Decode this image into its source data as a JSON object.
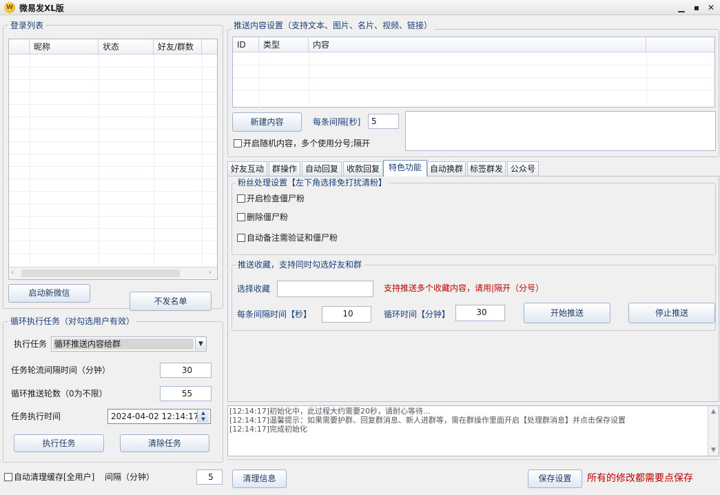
{
  "window": {
    "title": "微易发XL版",
    "icon": "W"
  },
  "login_list": {
    "title": "登录列表",
    "columns": [
      "昵称",
      "状态",
      "好友/群数"
    ],
    "start_button": "启动新微信",
    "blacklist_button": "不发名单"
  },
  "loop_task": {
    "title": "循环执行任务（对勾选用户有效）",
    "task_label": "执行任务",
    "task_value": "循环推送内容给群",
    "interval_label": "任务轮流间隔时间（分钟）",
    "interval_value": "30",
    "rounds_label": "循环推送轮数（0为不限）",
    "rounds_value": "55",
    "time_label": "任务执行时间",
    "time_value": "2024-04-02 12:14:17",
    "run_button": "执行任务",
    "clear_button": "清除任务"
  },
  "cache": {
    "checkbox_label": "自动清理缓存[全用户]",
    "interval_label": "间隔（分钟）",
    "interval_value": "5"
  },
  "push_content": {
    "title": "推送内容设置（支持文本、图片、名片、视频、链接）",
    "columns": [
      "ID",
      "类型",
      "内容"
    ],
    "new_button": "新建内容",
    "interval_label": "每条间隔[秒]",
    "interval_value": "5",
    "random_label": "开启随机内容，多个使用分号;隔开"
  },
  "tabs": [
    "好友互动",
    "群操作",
    "自动回复",
    "收款回复",
    "特色功能",
    "自动换群",
    "标签群发",
    "公众号"
  ],
  "active_tab": 4,
  "fans": {
    "title": "粉丝处理设置【左下角选择免打扰清粉】",
    "options": [
      "开启检查僵尸粉",
      "删除僵尸粉",
      "自动备注需验证和僵尸粉"
    ]
  },
  "favorites": {
    "title": "推送收藏，支持同时勾选好友和群",
    "select_label": "选择收藏",
    "select_value": "",
    "hint": "支持推送多个收藏内容，请用|隔开（分号）",
    "interval_label": "每条间隔时间【秒】",
    "interval_value": "10",
    "loop_label": "循环时间【分钟】",
    "loop_value": "30",
    "start_button": "开始推送",
    "stop_button": "停止推送"
  },
  "log": {
    "lines": [
      "[12:14:17]初始化中，此过程大约需要20秒，请耐心等待...",
      "[12:14:17]温馨提示：如果需要护群、回复群消息、新人进群等，需在群操作里面开启【处理群消息】并点击保存设置",
      "[12:14:17]完成初始化"
    ]
  },
  "footer": {
    "clear_button": "清理信息",
    "save_button": "保存设置",
    "save_hint": "所有的修改都需要点保存"
  },
  "colors": {
    "accent": "#1b3f7a",
    "warning": "#c00000"
  }
}
